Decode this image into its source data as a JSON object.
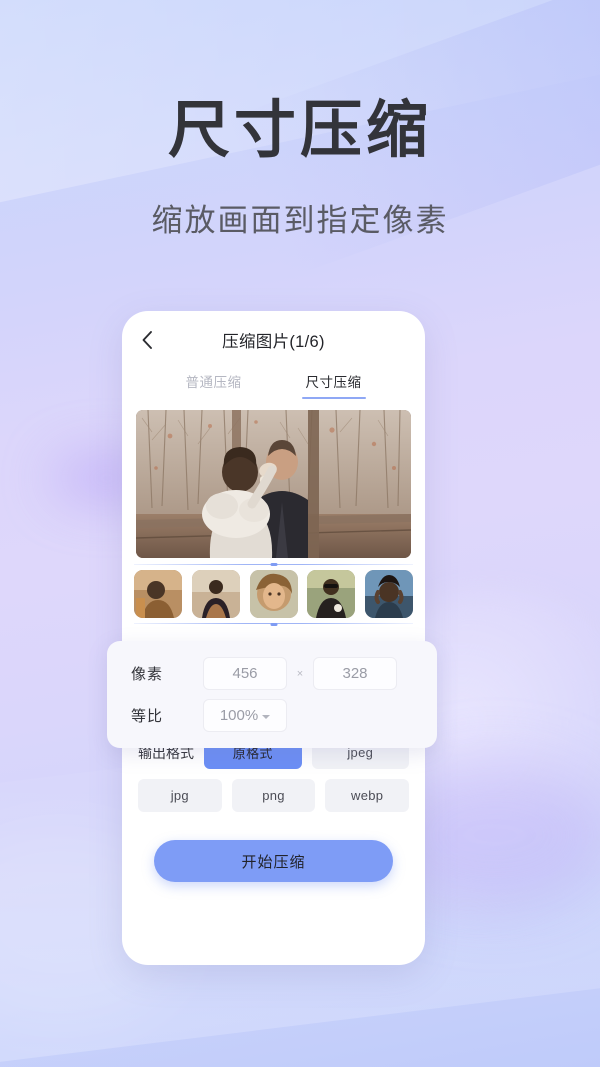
{
  "poster": {
    "headline": "尺寸压缩",
    "subhead": "缩放画面到指定像素"
  },
  "colors": {
    "accent": "#6b8ef5",
    "accent_soft": "#8fa8f5",
    "cta": "#7e9cf6",
    "bg_top": "#c3d1fb",
    "bg_mid": "#ded7fb",
    "bg_bottom": "#bfcbfa",
    "text_primary": "#33343a",
    "text_muted": "#b5b7c2"
  },
  "app": {
    "topbar": {
      "back_icon": "chevron-left-icon",
      "title": "压缩图片(1/6)"
    },
    "tabs": [
      {
        "label": "普通压缩",
        "active": false
      },
      {
        "label": "尺寸压缩",
        "active": true
      }
    ],
    "preview": {
      "alt": "婚礼照片预览"
    },
    "thumbnails": [
      {
        "alt": "缩略图1",
        "selected": false
      },
      {
        "alt": "缩略图2",
        "selected": false
      },
      {
        "alt": "缩略图3",
        "selected": true
      },
      {
        "alt": "缩略图4",
        "selected": false
      },
      {
        "alt": "缩略图5",
        "selected": false
      }
    ],
    "size_panel": {
      "pixel_label": "像素",
      "width_value": "456",
      "height_value": "328",
      "multiply_symbol": "×",
      "ratio_label": "等比",
      "ratio_value": "100%",
      "ratio_caret": "chevron-down-icon"
    },
    "output": {
      "label": "输出格式",
      "options": [
        {
          "label": "原格式",
          "selected": true
        },
        {
          "label": "jpeg",
          "selected": false
        },
        {
          "label": "jpg",
          "selected": false
        },
        {
          "label": "png",
          "selected": false
        },
        {
          "label": "webp",
          "selected": false
        }
      ]
    },
    "cta": {
      "label": "开始压缩"
    }
  }
}
